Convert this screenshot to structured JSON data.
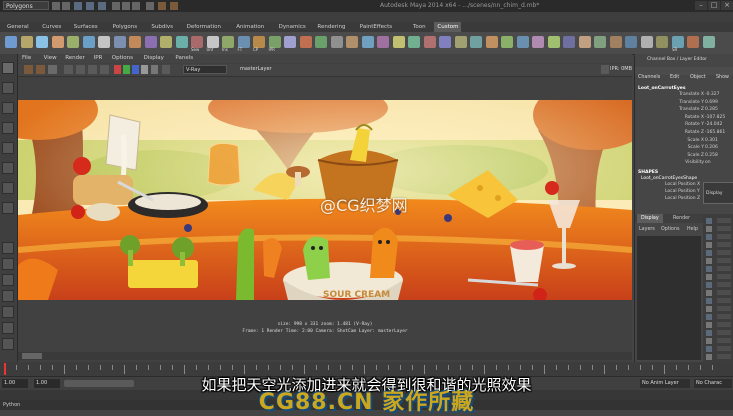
{
  "window": {
    "mode_menu": "Polygons",
    "title": "Autodesk Maya 2014 x64 - .../scenes/nn_chim_d.mb*"
  },
  "shelf_tabs": [
    "General",
    "Curves",
    "Surfaces",
    "Polygons",
    "Subdivs",
    "Deformation",
    "Animation",
    "Dynamics",
    "Rendering",
    "PaintEffects",
    "Toon",
    "Custom"
  ],
  "shelf_active_tab": "Custom",
  "shelf_labels": [
    "Sew",
    "Unf",
    "Ins",
    "FT",
    "CP",
    "IPR",
    "SR"
  ],
  "render_view": {
    "menus": [
      "File",
      "View",
      "Render",
      "IPR",
      "Options",
      "Display",
      "Panels"
    ],
    "renderer": "V-Ray",
    "layer": "masterLayer",
    "ipr_label": "IPR: 0MB",
    "info_line1": "size: 998 x 331  zoom: 1.481        (V-Ray)",
    "info_line2": "Frame: 1     Render Time: 2:00     Camera: ShotCam     Layer: masterLayer",
    "scene_text": "SOUR CREAM"
  },
  "channel_box": {
    "header": "Channel Box / Layer Editor",
    "menus": [
      "Channels",
      "Edit",
      "Object",
      "Show"
    ],
    "object": "Loot_onCarrotEyes",
    "attributes": [
      {
        "name": "Translate X",
        "value": "-0.327"
      },
      {
        "name": "Translate Y",
        "value": "0.699"
      },
      {
        "name": "Translate Z",
        "value": "0.285"
      },
      {
        "name": "Rotate X",
        "value": "-107.825"
      },
      {
        "name": "Rotate Y",
        "value": "-24.042"
      },
      {
        "name": "Rotate Z",
        "value": "-165.861"
      },
      {
        "name": "Scale X",
        "value": "0.301"
      },
      {
        "name": "Scale Y",
        "value": "0.206"
      },
      {
        "name": "Scale Z",
        "value": "0.258"
      },
      {
        "name": "Visibility",
        "value": "on"
      }
    ],
    "shapes_header": "SHAPES",
    "shape_name": "Loot_onCarrotEyesShape",
    "shape_attrs": [
      "Local Position X",
      "Local Position Y",
      "Local Position Z"
    ],
    "layer_tabs": [
      "Display",
      "Render"
    ],
    "layer_menus": [
      "Layers",
      "Options",
      "Help"
    ],
    "floating_tab": "Display"
  },
  "timeline": {
    "start": "1.00",
    "start2": "1.00",
    "anim_layer": "No Anim Layer",
    "character": "No Charac"
  },
  "command_line_label": "Python",
  "subtitle": "如果把天空光添加进来就会得到很和谐的光照效果",
  "watermarks": [
    "@CG织梦网",
    "CG88.CN 家作所藏"
  ]
}
